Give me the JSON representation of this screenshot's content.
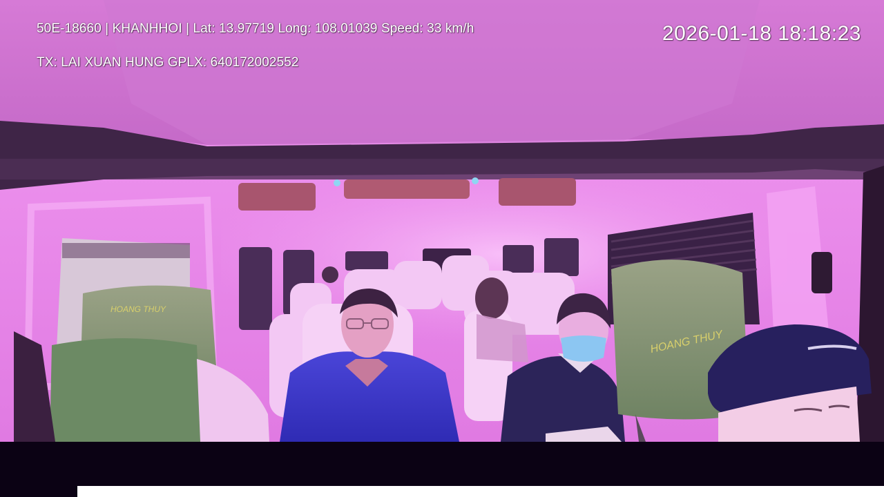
{
  "overlay": {
    "vehicle_info": "50E-18660 | KHANHHOI | Lat: 13.97719 Long: 108.01039 Speed: 33 km/h",
    "driver_info": "TX: LAI XUAN HUNG GPLX: 640172002552",
    "timestamp": "2026-01-18 18:18:23"
  },
  "seat_branding": {
    "left_headrest": "HOANG THUY",
    "right_headrest": "HOANG THUY"
  },
  "colors": {
    "cabin_tint": "#e882e8",
    "headrest_green": "#7f9470",
    "passenger_jacket": "#3b35c8",
    "bottom_band": "#0b0214"
  }
}
